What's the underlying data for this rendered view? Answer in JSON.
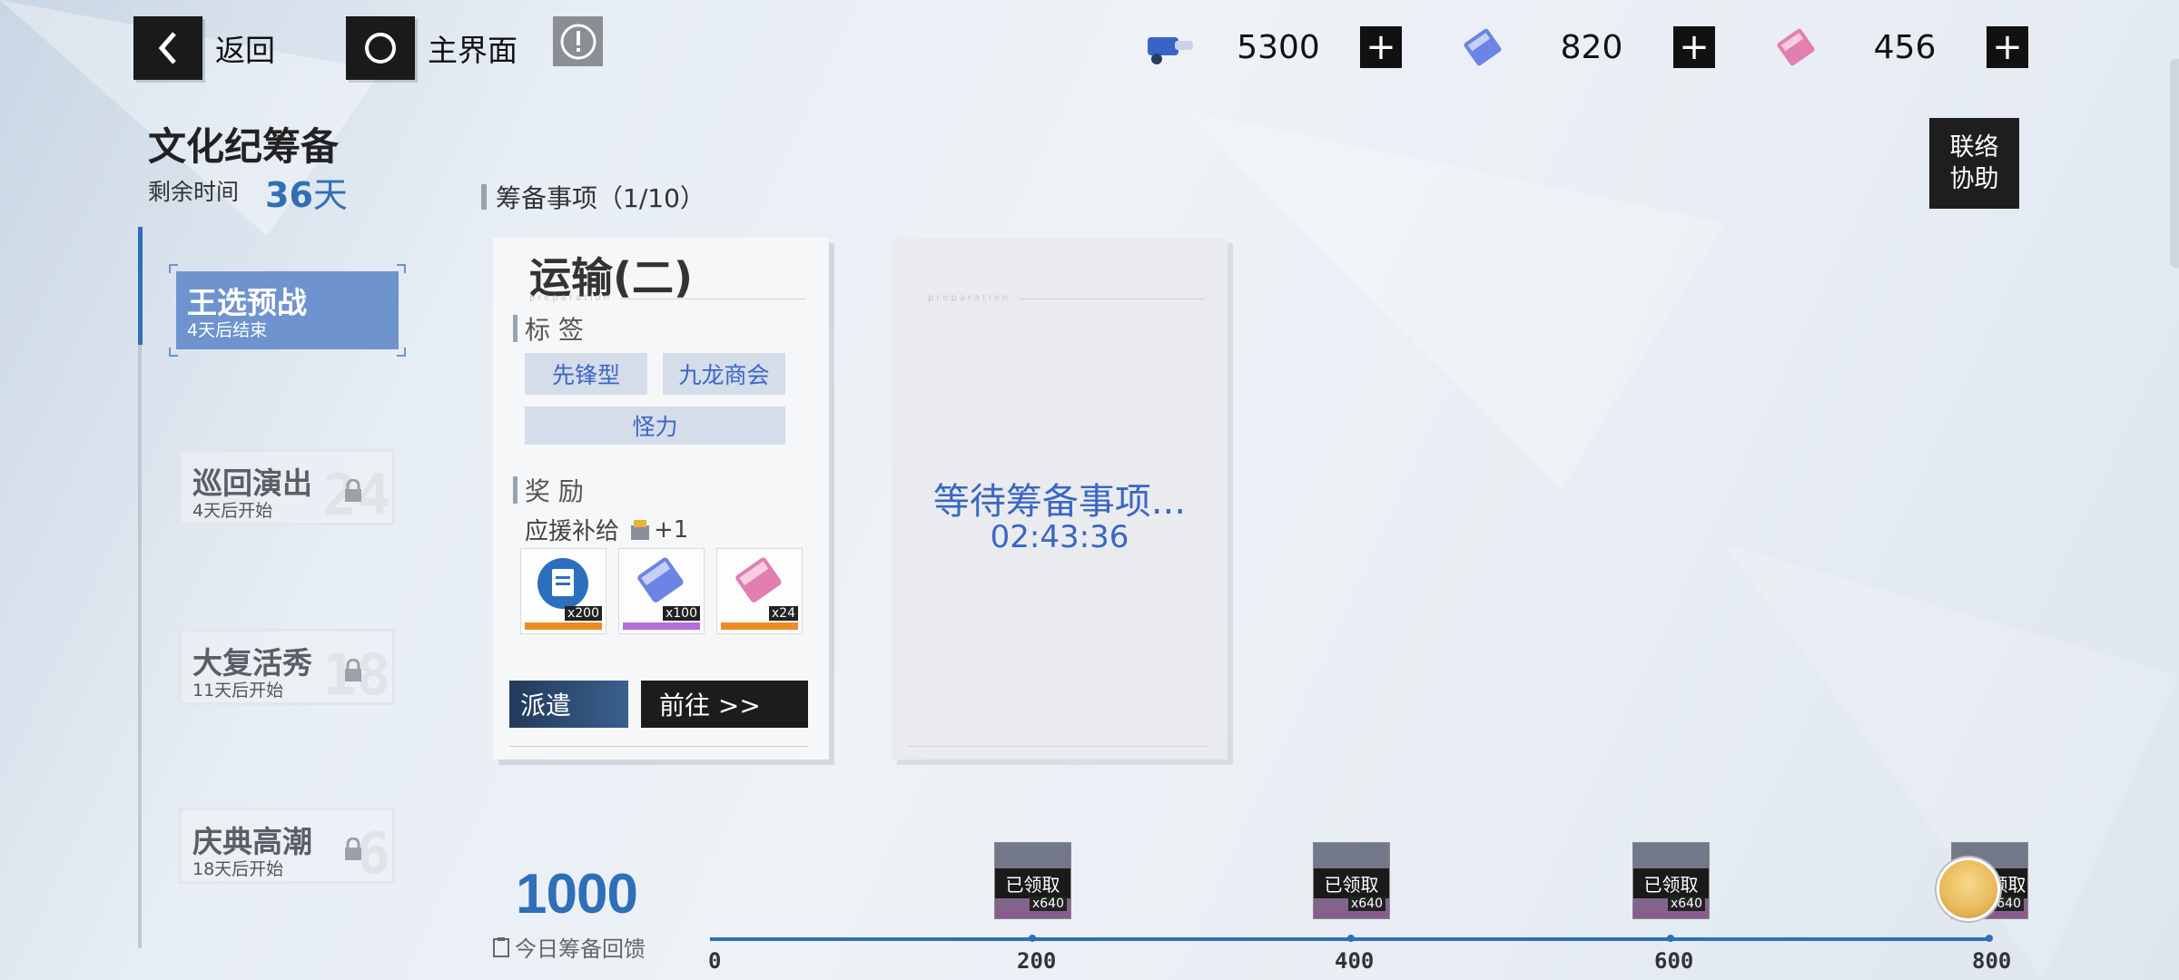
{
  "top_bar": {
    "back_label": "返回",
    "home_label": "主界面",
    "resources": [
      {
        "icon": "cannon-ticket-icon",
        "value": "5300",
        "color": "#3a63c8"
      },
      {
        "icon": "blue-supply-ticket-icon",
        "value": "820",
        "color": "#6b84e6"
      },
      {
        "icon": "pink-supply-ticket-icon",
        "value": "456",
        "color": "#e27fb0"
      }
    ],
    "plus_symbol": "+"
  },
  "event": {
    "title": "文化纪筹备",
    "remaining_label": "剩余时间",
    "remaining_value": "36",
    "remaining_unit": "天",
    "link_assist": [
      "联络",
      "协助"
    ]
  },
  "stages": [
    {
      "name": "王选预战",
      "sub": "4天后结束",
      "state": "active",
      "ghost": ""
    },
    {
      "name": "巡回演出",
      "sub": "4天后开始",
      "state": "locked",
      "ghost": "24"
    },
    {
      "name": "大复活秀",
      "sub": "11天后开始",
      "state": "locked",
      "ghost": "18"
    },
    {
      "name": "庆典高潮",
      "sub": "18天后开始",
      "state": "locked",
      "ghost": "6"
    }
  ],
  "section": {
    "heading": "筹备事项（1/10）"
  },
  "task_card": {
    "title": "运输(二)",
    "watermark": "preparation",
    "tags_heading": "标 签",
    "tags": [
      "先锋型",
      "九龙商会",
      "怪力"
    ],
    "reward_heading": "奖 励",
    "support_label": "应援补给",
    "support_count": "+1",
    "rewards": [
      {
        "icon": "clipboard-supply-icon",
        "count": "x200",
        "tier_color": "#f08a24"
      },
      {
        "icon": "blue-supply-ticket-icon",
        "count": "x100",
        "tier_color": "#b56fd6"
      },
      {
        "icon": "pink-supply-ticket-icon",
        "count": "x24",
        "tier_color": "#f08a24"
      }
    ],
    "dispatch_label": "派遣",
    "goto_label": "前往 >>"
  },
  "waiting_card": {
    "watermark": "preparation",
    "text": "等待筹备事项...",
    "timer": "02:43:36"
  },
  "progress": {
    "score": "1000",
    "score_label": "今日筹备回馈",
    "fraction": 1.0,
    "ticks": [
      "0",
      "200",
      "400",
      "600",
      "800"
    ],
    "milestones": [
      {
        "label": "已领取",
        "count": "x640"
      },
      {
        "label": "已领取",
        "count": "x640"
      },
      {
        "label": "已领取",
        "count": "x640"
      },
      {
        "label": "领取",
        "count": "x640"
      }
    ]
  }
}
